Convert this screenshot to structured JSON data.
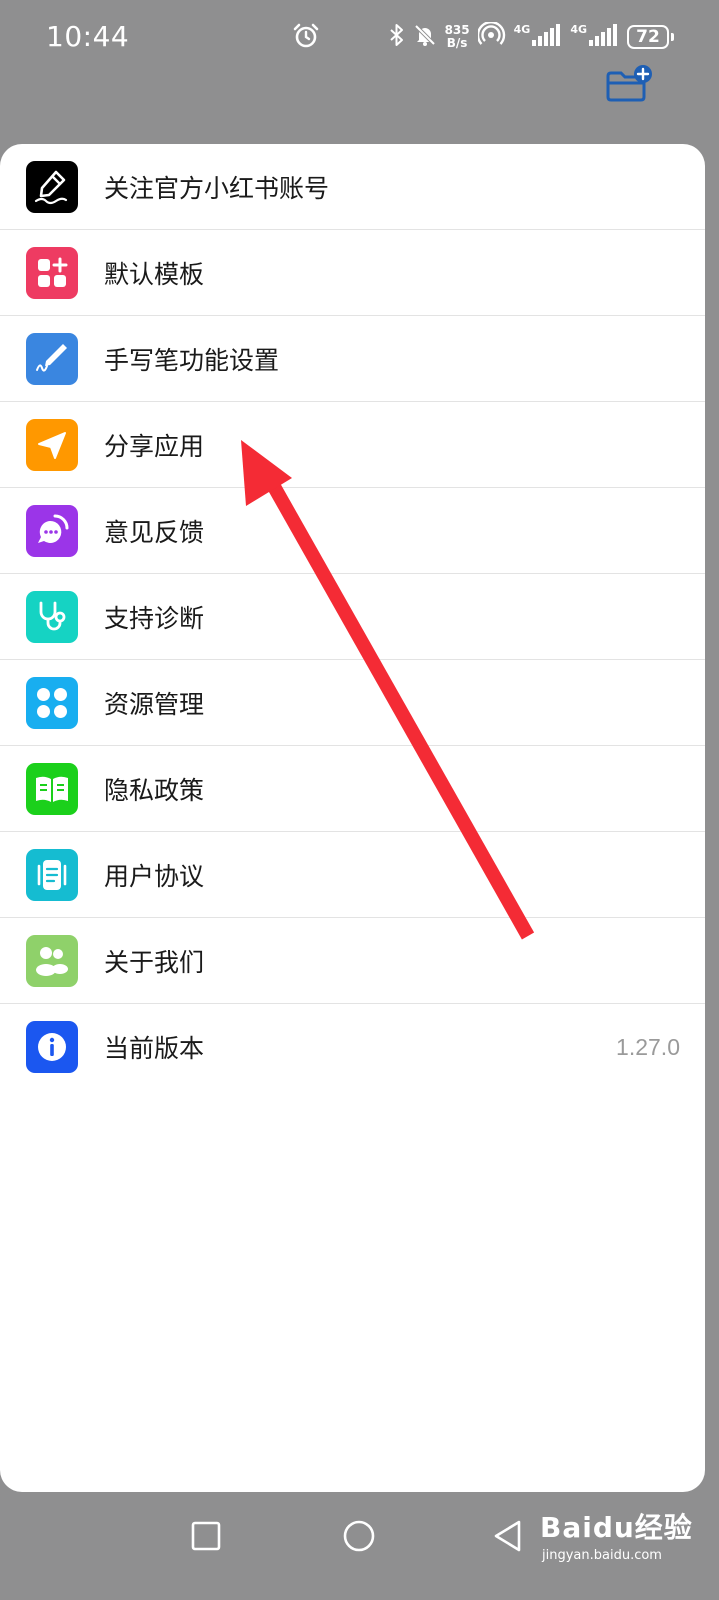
{
  "status_bar": {
    "time": "10:44",
    "net_speed_value": "835",
    "net_speed_unit": "B/s",
    "sim1_type": "4G",
    "sim2_type": "4G",
    "battery": "72",
    "icons": [
      "alarm-icon",
      "bluetooth-icon",
      "mute-icon",
      "hotspot-icon",
      "signal-icon",
      "signal-icon",
      "battery-icon"
    ]
  },
  "header": {
    "action_icon": "folder-add-icon",
    "accent_color": "#1e5fb4"
  },
  "menu": {
    "items": [
      {
        "label": "关注官方小红书账号",
        "icon": "pen-sign-icon",
        "color": "#000000"
      },
      {
        "label": "默认模板",
        "icon": "template-grid-icon",
        "color": "#ee3b62"
      },
      {
        "label": "手写笔功能设置",
        "icon": "stylus-icon",
        "color": "#3a86e0"
      },
      {
        "label": "分享应用",
        "icon": "send-icon",
        "color": "#ff9800"
      },
      {
        "label": "意见反馈",
        "icon": "feedback-chat-icon",
        "color": "#9b35e8"
      },
      {
        "label": "支持诊断",
        "icon": "stethoscope-icon",
        "color": "#15d3c3"
      },
      {
        "label": "资源管理",
        "icon": "four-petal-icon",
        "color": "#18aef0"
      },
      {
        "label": "隐私政策",
        "icon": "open-book-icon",
        "color": "#1bd01b"
      },
      {
        "label": "用户协议",
        "icon": "document-icon",
        "color": "#15bcd1"
      },
      {
        "label": "关于我们",
        "icon": "people-icon",
        "color": "#8fd16a"
      },
      {
        "label": "当前版本",
        "icon": "info-icon",
        "color": "#1b57f0",
        "value": "1.27.0"
      }
    ]
  },
  "annotation": {
    "arrow_color": "#f42b35"
  },
  "nav_bar": {
    "buttons": [
      "recent-apps-icon",
      "home-icon",
      "back-icon"
    ]
  },
  "watermark": {
    "main": "Baidu经验",
    "sub": "jingyan.baidu.com"
  }
}
